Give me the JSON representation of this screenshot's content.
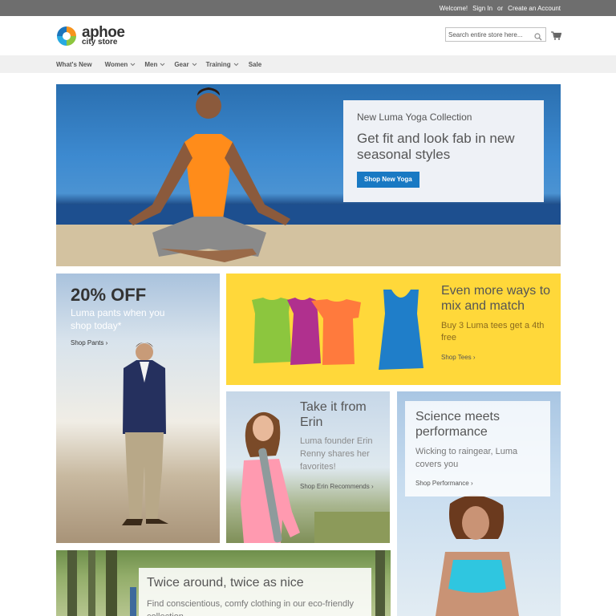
{
  "topbar": {
    "welcome": "Welcome!",
    "sign_in": "Sign In",
    "or": "or",
    "create_account": "Create an Account"
  },
  "header": {
    "logo_line1": "aphoe",
    "logo_line2": "city store",
    "search_placeholder": "Search entire store here...",
    "icons": [
      "search-icon",
      "cart-icon"
    ]
  },
  "nav": {
    "items": [
      {
        "label": "What's New",
        "has_dropdown": false
      },
      {
        "label": "Women",
        "has_dropdown": true
      },
      {
        "label": "Men",
        "has_dropdown": true
      },
      {
        "label": "Gear",
        "has_dropdown": true
      },
      {
        "label": "Training",
        "has_dropdown": true
      },
      {
        "label": "Sale",
        "has_dropdown": false
      }
    ]
  },
  "hero": {
    "kicker": "New Luma Yoga Collection",
    "headline": "Get fit and look fab in new seasonal styles",
    "button": "Shop New Yoga"
  },
  "promo_pants": {
    "title": "20% OFF",
    "text": "Luma pants when you shop today*",
    "link": "Shop Pants"
  },
  "promo_tees": {
    "title": "Even more ways to mix and match",
    "text": "Buy 3 Luma tees get a 4th free",
    "link": "Shop Tees"
  },
  "promo_erin": {
    "title": "Take it from Erin",
    "text": "Luma founder Erin Renny shares her favorites!",
    "link": "Shop Erin Recommends"
  },
  "promo_performance": {
    "title": "Science meets performance",
    "text": "Wicking to raingear, Luma covers you",
    "link": "Shop Performance"
  },
  "promo_eco": {
    "title": "Twice around, twice as nice",
    "text": "Find conscientious, comfy clothing in our eco-friendly collection"
  },
  "colors": {
    "topbar": "#6e6e6e",
    "nav_bg": "#f0f0f0",
    "primary_button": "#1979c3",
    "tees_bg": "#ffd83a"
  }
}
